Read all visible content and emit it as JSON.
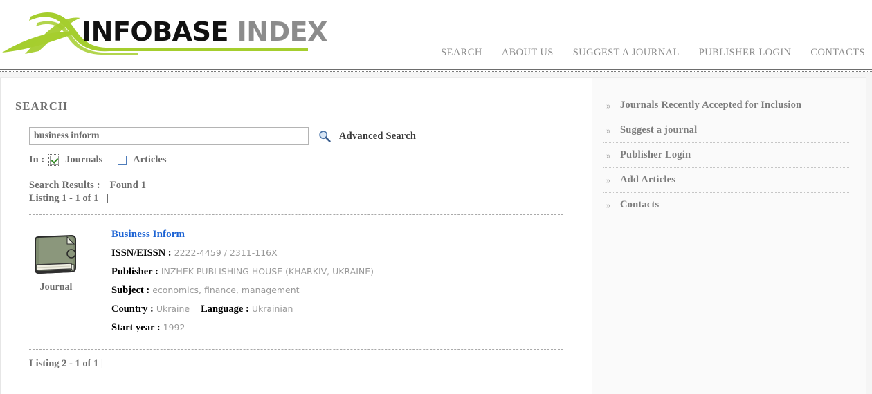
{
  "brand": {
    "name_primary": "INFOBASE",
    "name_secondary": "INDEX",
    "accent_green": "#a5ce2e",
    "primary_color": "#111111",
    "secondary_color": "#8c8c8c"
  },
  "nav": {
    "items": [
      {
        "label": "SEARCH",
        "name": "nav-search"
      },
      {
        "label": "ABOUT US",
        "name": "nav-about-us"
      },
      {
        "label": "SUGGEST A JOURNAL",
        "name": "nav-suggest-a-journal"
      },
      {
        "label": "PUBLISHER LOGIN",
        "name": "nav-publisher-login"
      },
      {
        "label": "CONTACTS",
        "name": "nav-contacts"
      }
    ]
  },
  "search": {
    "heading": "SEARCH",
    "query_value": "business inform",
    "query_placeholder": "",
    "advanced_link": "Advanced Search",
    "in_label": "In :",
    "scope": {
      "journals_label": "Journals",
      "journals_checked": true,
      "articles_label": "Articles",
      "articles_checked": false
    },
    "results_label": "Search Results :",
    "results_value": "Found 1",
    "listing_top": "Listing  1 - 1 of 1",
    "listing_separator": "|",
    "listing_bottom": "Listing  2 - 1 of 1"
  },
  "result": {
    "icon_label": "Journal",
    "title": "Business Inform",
    "fields": [
      {
        "key": "ISSN/EISSN :",
        "value": "2222-4459 / 2311-116X"
      },
      {
        "key": "Publisher :",
        "value": "INZHEK PUBLISHING HOUSE (KHARKIV, UKRAINE)"
      },
      {
        "key": "Subject :",
        "value": "economics, finance, management"
      }
    ],
    "country_key": "Country :",
    "country_value": "Ukraine",
    "language_key": "Language :",
    "language_value": "Ukrainian",
    "startyear_key": "Start year :",
    "startyear_value": "1992"
  },
  "sidebar": {
    "items": [
      {
        "label": "Journals Recently Accepted for Inclusion",
        "name": "sidebar-item-journals-recently-accepted"
      },
      {
        "label": "Suggest a journal",
        "name": "sidebar-item-suggest-a-journal"
      },
      {
        "label": "Publisher Login",
        "name": "sidebar-item-publisher-login"
      },
      {
        "label": "Add Articles",
        "name": "sidebar-item-add-articles"
      },
      {
        "label": "Contacts",
        "name": "sidebar-item-contacts"
      }
    ],
    "chevron": "»"
  }
}
